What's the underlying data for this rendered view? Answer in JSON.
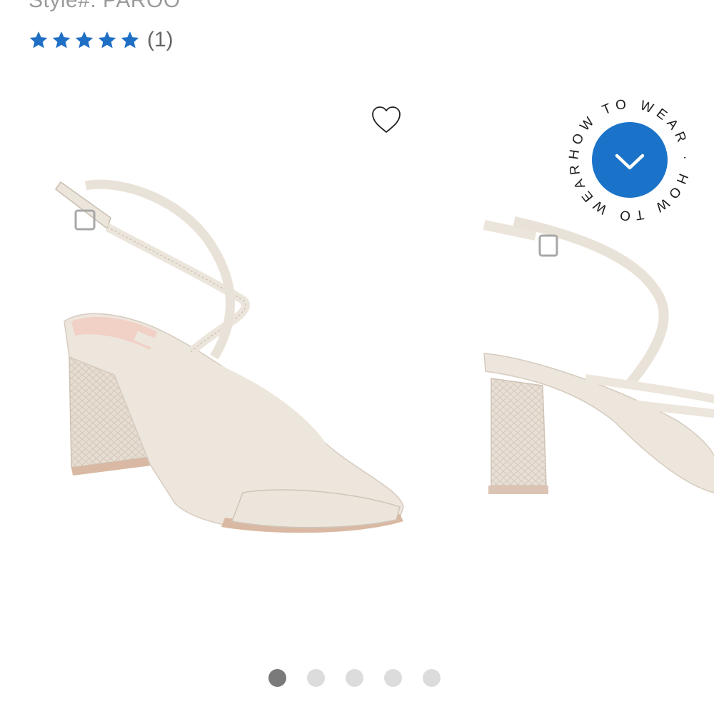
{
  "product": {
    "style_line": "Style#: PAROO",
    "rating": {
      "stars": 5,
      "max_stars": 5,
      "review_count_label": "(1)"
    }
  },
  "colors": {
    "accent": "#1f6fc5",
    "badge_blue": "#1a73c8",
    "dot_active": "#7a7a7a",
    "dot_inactive": "#dcdcdc"
  },
  "icons": {
    "wishlist": "heart-outline-icon",
    "how_to_wear": "chevron-down-icon",
    "rating": "star-icon"
  },
  "badge": {
    "text": "HOW TO WEAR · HOW TO WEAR ·"
  },
  "carousel": {
    "slides": [
      {
        "name": "sandal-three-quarter-view"
      },
      {
        "name": "sandal-side-view"
      }
    ],
    "active_index": 0,
    "dots": [
      {
        "active": true
      },
      {
        "active": false
      },
      {
        "active": false
      },
      {
        "active": false
      },
      {
        "active": false
      }
    ]
  }
}
